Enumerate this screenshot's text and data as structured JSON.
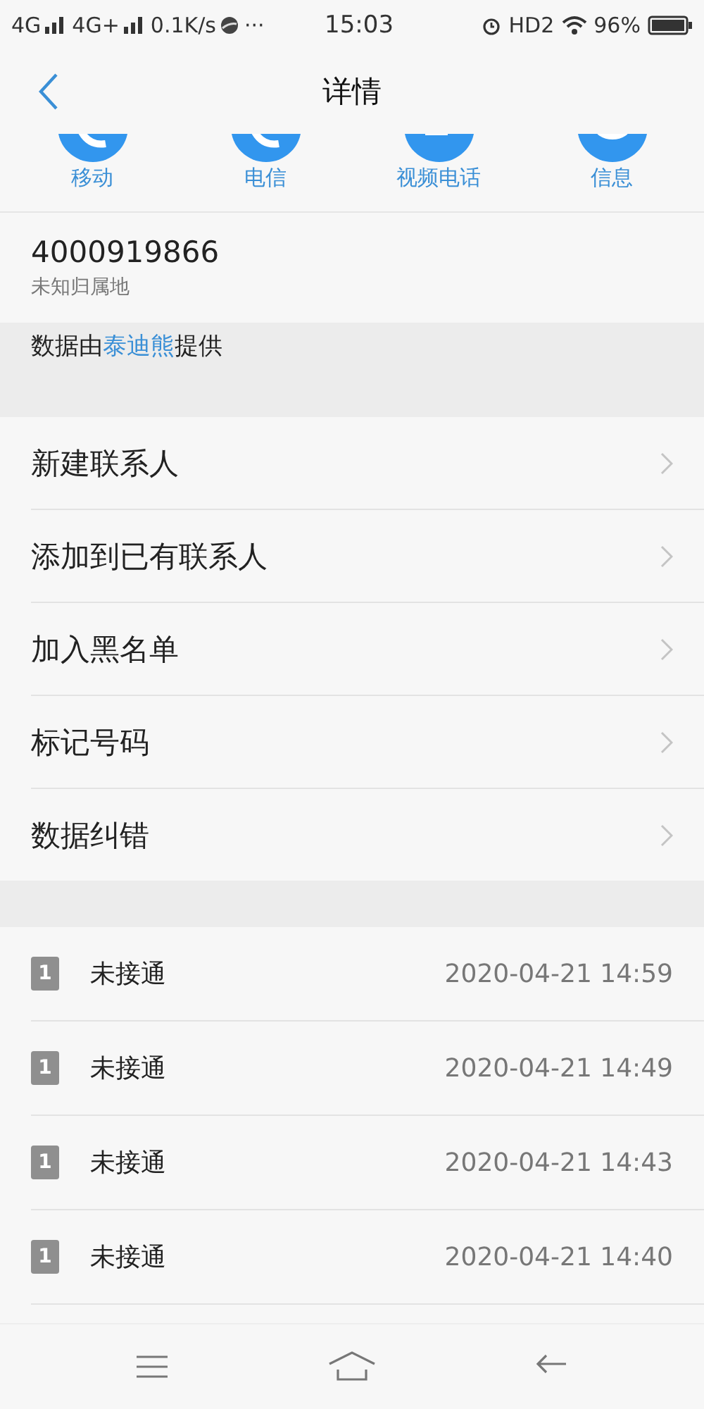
{
  "status_bar": {
    "network_1": "4G",
    "network_2": "4G+",
    "speed": "0.1K/s",
    "more": "···",
    "time": "15:03",
    "hd": "HD2",
    "battery": "96%"
  },
  "header": {
    "title": "详情"
  },
  "actions": [
    {
      "label": "移动",
      "kind": "call"
    },
    {
      "label": "电信",
      "kind": "call"
    },
    {
      "label": "视频电话",
      "kind": "video"
    },
    {
      "label": "信息",
      "kind": "message"
    }
  ],
  "contact": {
    "number": "4000919866",
    "location": "未知归属地",
    "source_before": "数据由",
    "source_link": "泰迪熊",
    "source_after": "提供"
  },
  "menu": [
    "新建联系人",
    "添加到已有联系人",
    "加入黑名单",
    "标记号码",
    "数据纠错"
  ],
  "calls": [
    {
      "sim": "1",
      "status": "未接通",
      "time": "2020-04-21 14:59"
    },
    {
      "sim": "1",
      "status": "未接通",
      "time": "2020-04-21 14:49"
    },
    {
      "sim": "1",
      "status": "未接通",
      "time": "2020-04-21 14:43"
    },
    {
      "sim": "1",
      "status": "未接通",
      "time": "2020-04-21 14:40"
    }
  ]
}
